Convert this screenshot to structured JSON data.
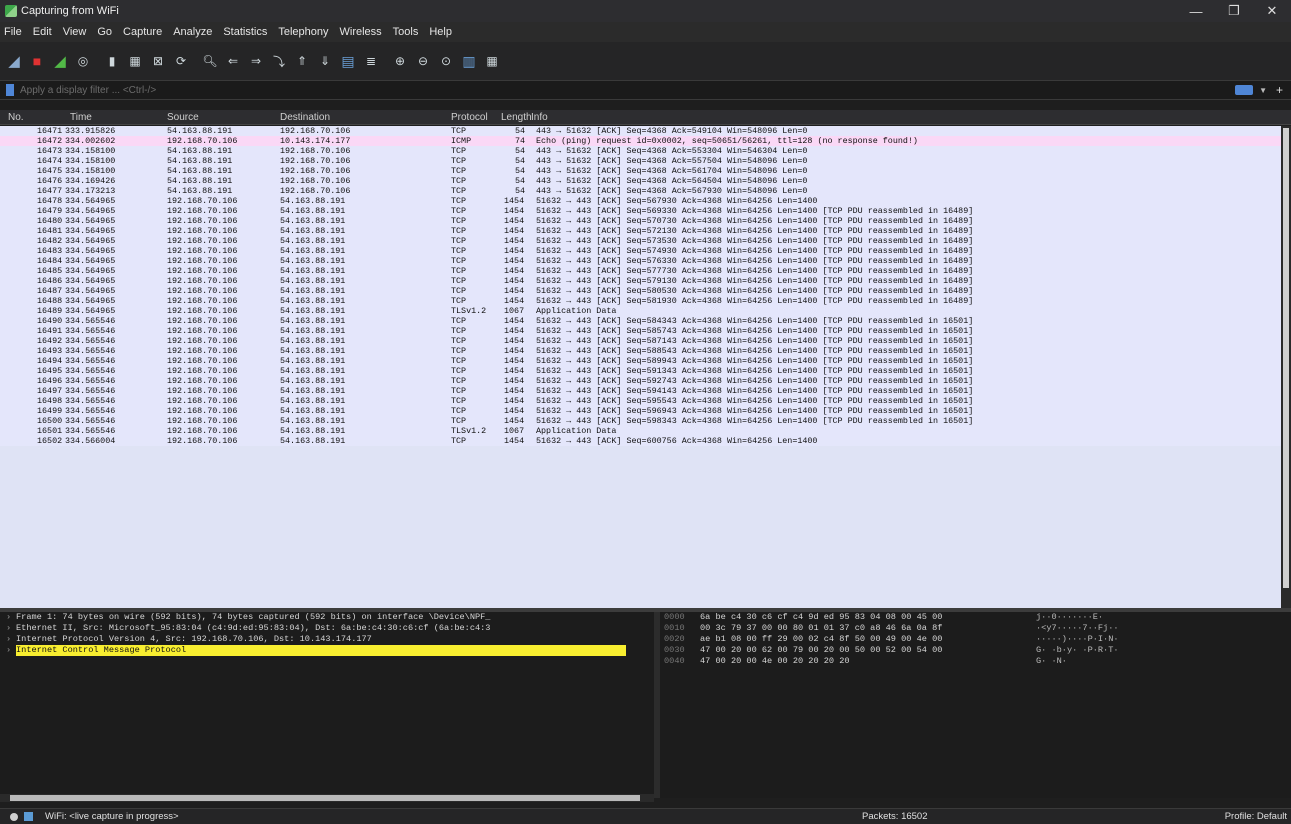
{
  "window": {
    "title": "Capturing from WiFi",
    "controls": [
      "—",
      "❐",
      "✕"
    ]
  },
  "menu": [
    "File",
    "Edit",
    "View",
    "Go",
    "Capture",
    "Analyze",
    "Statistics",
    "Telephony",
    "Wireless",
    "Tools",
    "Help"
  ],
  "filter": {
    "placeholder": "Apply a display filter ... <Ctrl-/>"
  },
  "columns": {
    "no": "No.",
    "time": "Time",
    "source": "Source",
    "destination": "Destination",
    "protocol": "Protocol",
    "length": "Length",
    "info": "Info"
  },
  "packets": [
    {
      "no": "16471",
      "time": "333.915826",
      "src": "54.163.88.191",
      "dst": "192.168.70.106",
      "proto": "TCP",
      "len": "54",
      "info": "443 → 51632 [ACK] Seq=4368 Ack=549104 Win=548096 Len=0"
    },
    {
      "no": "16472",
      "time": "334.002602",
      "src": "192.168.70.106",
      "dst": "10.143.174.177",
      "proto": "ICMP",
      "len": "74",
      "info": "Echo (ping) request  id=0x0002, seq=50651/56261, ttl=128 (no response found!)"
    },
    {
      "no": "16473",
      "time": "334.158100",
      "src": "54.163.88.191",
      "dst": "192.168.70.106",
      "proto": "TCP",
      "len": "54",
      "info": "443 → 51632 [ACK] Seq=4368 Ack=553304 Win=546304 Len=0"
    },
    {
      "no": "16474",
      "time": "334.158100",
      "src": "54.163.88.191",
      "dst": "192.168.70.106",
      "proto": "TCP",
      "len": "54",
      "info": "443 → 51632 [ACK] Seq=4368 Ack=557504 Win=548096 Len=0"
    },
    {
      "no": "16475",
      "time": "334.158100",
      "src": "54.163.88.191",
      "dst": "192.168.70.106",
      "proto": "TCP",
      "len": "54",
      "info": "443 → 51632 [ACK] Seq=4368 Ack=561704 Win=548096 Len=0"
    },
    {
      "no": "16476",
      "time": "334.169426",
      "src": "54.163.88.191",
      "dst": "192.168.70.106",
      "proto": "TCP",
      "len": "54",
      "info": "443 → 51632 [ACK] Seq=4368 Ack=564504 Win=548096 Len=0"
    },
    {
      "no": "16477",
      "time": "334.173213",
      "src": "54.163.88.191",
      "dst": "192.168.70.106",
      "proto": "TCP",
      "len": "54",
      "info": "443 → 51632 [ACK] Seq=4368 Ack=567930 Win=548096 Len=0"
    },
    {
      "no": "16478",
      "time": "334.564965",
      "src": "192.168.70.106",
      "dst": "54.163.88.191",
      "proto": "TCP",
      "len": "1454",
      "info": "51632 → 443 [ACK] Seq=567930 Ack=4368 Win=64256 Len=1400"
    },
    {
      "no": "16479",
      "time": "334.564965",
      "src": "192.168.70.106",
      "dst": "54.163.88.191",
      "proto": "TCP",
      "len": "1454",
      "info": "51632 → 443 [ACK] Seq=569330 Ack=4368 Win=64256 Len=1400 [TCP PDU reassembled in 16489]"
    },
    {
      "no": "16480",
      "time": "334.564965",
      "src": "192.168.70.106",
      "dst": "54.163.88.191",
      "proto": "TCP",
      "len": "1454",
      "info": "51632 → 443 [ACK] Seq=570730 Ack=4368 Win=64256 Len=1400 [TCP PDU reassembled in 16489]"
    },
    {
      "no": "16481",
      "time": "334.564965",
      "src": "192.168.70.106",
      "dst": "54.163.88.191",
      "proto": "TCP",
      "len": "1454",
      "info": "51632 → 443 [ACK] Seq=572130 Ack=4368 Win=64256 Len=1400 [TCP PDU reassembled in 16489]"
    },
    {
      "no": "16482",
      "time": "334.564965",
      "src": "192.168.70.106",
      "dst": "54.163.88.191",
      "proto": "TCP",
      "len": "1454",
      "info": "51632 → 443 [ACK] Seq=573530 Ack=4368 Win=64256 Len=1400 [TCP PDU reassembled in 16489]"
    },
    {
      "no": "16483",
      "time": "334.564965",
      "src": "192.168.70.106",
      "dst": "54.163.88.191",
      "proto": "TCP",
      "len": "1454",
      "info": "51632 → 443 [ACK] Seq=574930 Ack=4368 Win=64256 Len=1400 [TCP PDU reassembled in 16489]"
    },
    {
      "no": "16484",
      "time": "334.564965",
      "src": "192.168.70.106",
      "dst": "54.163.88.191",
      "proto": "TCP",
      "len": "1454",
      "info": "51632 → 443 [ACK] Seq=576330 Ack=4368 Win=64256 Len=1400 [TCP PDU reassembled in 16489]"
    },
    {
      "no": "16485",
      "time": "334.564965",
      "src": "192.168.70.106",
      "dst": "54.163.88.191",
      "proto": "TCP",
      "len": "1454",
      "info": "51632 → 443 [ACK] Seq=577730 Ack=4368 Win=64256 Len=1400 [TCP PDU reassembled in 16489]"
    },
    {
      "no": "16486",
      "time": "334.564965",
      "src": "192.168.70.106",
      "dst": "54.163.88.191",
      "proto": "TCP",
      "len": "1454",
      "info": "51632 → 443 [ACK] Seq=579130 Ack=4368 Win=64256 Len=1400 [TCP PDU reassembled in 16489]"
    },
    {
      "no": "16487",
      "time": "334.564965",
      "src": "192.168.70.106",
      "dst": "54.163.88.191",
      "proto": "TCP",
      "len": "1454",
      "info": "51632 → 443 [ACK] Seq=580530 Ack=4368 Win=64256 Len=1400 [TCP PDU reassembled in 16489]"
    },
    {
      "no": "16488",
      "time": "334.564965",
      "src": "192.168.70.106",
      "dst": "54.163.88.191",
      "proto": "TCP",
      "len": "1454",
      "info": "51632 → 443 [ACK] Seq=581930 Ack=4368 Win=64256 Len=1400 [TCP PDU reassembled in 16489]"
    },
    {
      "no": "16489",
      "time": "334.564965",
      "src": "192.168.70.106",
      "dst": "54.163.88.191",
      "proto": "TLSv1.2",
      "len": "1067",
      "info": "Application Data"
    },
    {
      "no": "16490",
      "time": "334.565546",
      "src": "192.168.70.106",
      "dst": "54.163.88.191",
      "proto": "TCP",
      "len": "1454",
      "info": "51632 → 443 [ACK] Seq=584343 Ack=4368 Win=64256 Len=1400 [TCP PDU reassembled in 16501]"
    },
    {
      "no": "16491",
      "time": "334.565546",
      "src": "192.168.70.106",
      "dst": "54.163.88.191",
      "proto": "TCP",
      "len": "1454",
      "info": "51632 → 443 [ACK] Seq=585743 Ack=4368 Win=64256 Len=1400 [TCP PDU reassembled in 16501]"
    },
    {
      "no": "16492",
      "time": "334.565546",
      "src": "192.168.70.106",
      "dst": "54.163.88.191",
      "proto": "TCP",
      "len": "1454",
      "info": "51632 → 443 [ACK] Seq=587143 Ack=4368 Win=64256 Len=1400 [TCP PDU reassembled in 16501]"
    },
    {
      "no": "16493",
      "time": "334.565546",
      "src": "192.168.70.106",
      "dst": "54.163.88.191",
      "proto": "TCP",
      "len": "1454",
      "info": "51632 → 443 [ACK] Seq=588543 Ack=4368 Win=64256 Len=1400 [TCP PDU reassembled in 16501]"
    },
    {
      "no": "16494",
      "time": "334.565546",
      "src": "192.168.70.106",
      "dst": "54.163.88.191",
      "proto": "TCP",
      "len": "1454",
      "info": "51632 → 443 [ACK] Seq=589943 Ack=4368 Win=64256 Len=1400 [TCP PDU reassembled in 16501]"
    },
    {
      "no": "16495",
      "time": "334.565546",
      "src": "192.168.70.106",
      "dst": "54.163.88.191",
      "proto": "TCP",
      "len": "1454",
      "info": "51632 → 443 [ACK] Seq=591343 Ack=4368 Win=64256 Len=1400 [TCP PDU reassembled in 16501]"
    },
    {
      "no": "16496",
      "time": "334.565546",
      "src": "192.168.70.106",
      "dst": "54.163.88.191",
      "proto": "TCP",
      "len": "1454",
      "info": "51632 → 443 [ACK] Seq=592743 Ack=4368 Win=64256 Len=1400 [TCP PDU reassembled in 16501]"
    },
    {
      "no": "16497",
      "time": "334.565546",
      "src": "192.168.70.106",
      "dst": "54.163.88.191",
      "proto": "TCP",
      "len": "1454",
      "info": "51632 → 443 [ACK] Seq=594143 Ack=4368 Win=64256 Len=1400 [TCP PDU reassembled in 16501]"
    },
    {
      "no": "16498",
      "time": "334.565546",
      "src": "192.168.70.106",
      "dst": "54.163.88.191",
      "proto": "TCP",
      "len": "1454",
      "info": "51632 → 443 [ACK] Seq=595543 Ack=4368 Win=64256 Len=1400 [TCP PDU reassembled in 16501]"
    },
    {
      "no": "16499",
      "time": "334.565546",
      "src": "192.168.70.106",
      "dst": "54.163.88.191",
      "proto": "TCP",
      "len": "1454",
      "info": "51632 → 443 [ACK] Seq=596943 Ack=4368 Win=64256 Len=1400 [TCP PDU reassembled in 16501]"
    },
    {
      "no": "16500",
      "time": "334.565546",
      "src": "192.168.70.106",
      "dst": "54.163.88.191",
      "proto": "TCP",
      "len": "1454",
      "info": "51632 → 443 [ACK] Seq=598343 Ack=4368 Win=64256 Len=1400 [TCP PDU reassembled in 16501]"
    },
    {
      "no": "16501",
      "time": "334.565546",
      "src": "192.168.70.106",
      "dst": "54.163.88.191",
      "proto": "TLSv1.2",
      "len": "1067",
      "info": "Application Data"
    },
    {
      "no": "16502",
      "time": "334.566004",
      "src": "192.168.70.106",
      "dst": "54.163.88.191",
      "proto": "TCP",
      "len": "1454",
      "info": "51632 → 443 [ACK] Seq=600756 Ack=4368 Win=64256 Len=1400"
    }
  ],
  "details": [
    {
      "text": "Frame 1: 74 bytes on wire (592 bits), 74 bytes captured (592 bits) on interface \\Device\\NPF_",
      "selected": false
    },
    {
      "text": "Ethernet II, Src: Microsoft_95:83:04 (c4:9d:ed:95:83:04), Dst: 6a:be:c4:30:c6:cf (6a:be:c4:3",
      "selected": false
    },
    {
      "text": "Internet Protocol Version 4, Src: 192.168.70.106, Dst: 10.143.174.177",
      "selected": false
    },
    {
      "text": "Internet Control Message Protocol",
      "selected": true
    }
  ],
  "bytes": [
    {
      "off": "0000",
      "hex": "6a be c4 30 c6 cf c4 9d  ed 95 83 04 08 00 45 00",
      "ascii": "j··0·······E·"
    },
    {
      "off": "0010",
      "hex": "00 3c 79 37 00 00 80 01  01 37 c0 a8 46 6a 0a 8f",
      "ascii": "·<y7·····7··Fj··"
    },
    {
      "off": "0020",
      "hex": "ae b1 08 00 ff 29 00 02  c4 8f 50 00 49 00 4e 00",
      "ascii": "·····)····P·I·N·"
    },
    {
      "off": "0030",
      "hex": "47 00 20 00 62 00 79 00  20 00 50 00 52 00 54 00",
      "ascii": "G· ·b·y· ·P·R·T·"
    },
    {
      "off": "0040",
      "hex": "47 00 20 00 4e 00 20 20  20 20",
      "ascii": "G· ·N·"
    }
  ],
  "status": {
    "capture": "WiFi: <live capture in progress>",
    "packets": "Packets: 16502",
    "profile": "Profile: Default"
  },
  "colors": {
    "tcp_row": "#e4e6fb",
    "icmp_row": "#fad8f6",
    "selected_detail": "#f8ee30"
  }
}
